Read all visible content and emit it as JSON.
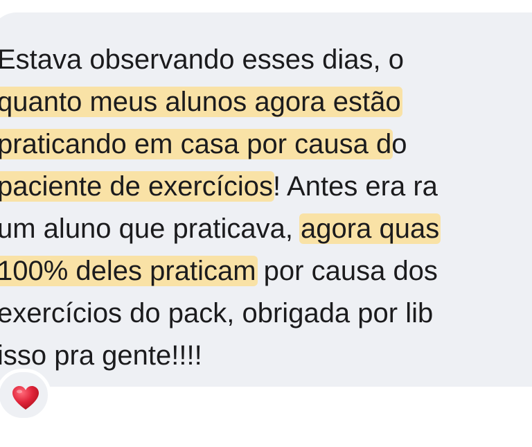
{
  "message": {
    "lines": [
      [
        {
          "text": "Estava observando esses dias, o",
          "hl": false
        }
      ],
      [
        {
          "text": "quanto meus alunos agora estão",
          "hl": true
        }
      ],
      [
        {
          "text": "praticando em casa por causa d",
          "hl": true
        },
        {
          "text": "o",
          "hl": false
        }
      ],
      [
        {
          "text": "paciente de exercícios",
          "hl": true
        },
        {
          "text": "! Antes era ra",
          "hl": false
        }
      ],
      [
        {
          "text": "um aluno que praticava, ",
          "hl": false
        },
        {
          "text": "agora quas",
          "hl": true
        }
      ],
      [
        {
          "text": "100% deles praticam",
          "hl": true
        },
        {
          "text": " por causa dos",
          "hl": false
        }
      ],
      [
        {
          "text": "exercícios do pack, obrigada por lib",
          "hl": false
        }
      ],
      [
        {
          "text": "isso pra gente!!!!",
          "hl": false
        }
      ]
    ]
  },
  "reaction": {
    "icon": "heart-icon",
    "color": "#e0243a"
  },
  "colors": {
    "bubble": "#eef0f4",
    "highlight": "#f9e2a6",
    "text": "#1b1b1d"
  }
}
